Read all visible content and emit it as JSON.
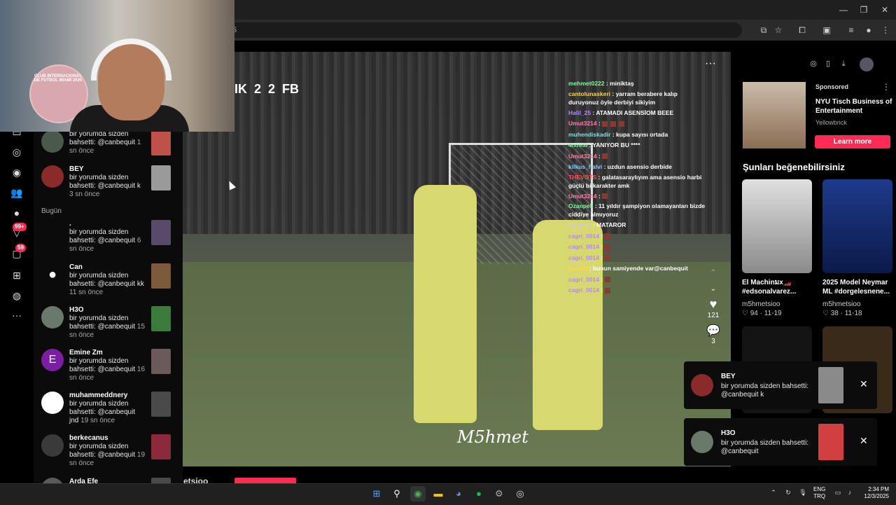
{
  "browser": {
    "url_partial": "5",
    "window_controls": [
      "minimize",
      "maximize",
      "close"
    ]
  },
  "notifications": {
    "section_today": "Bugün",
    "items": [
      {
        "name": "",
        "text": "bir yorumda sizden bahsetti: @canbequit",
        "time": "1 sn önce",
        "avatar": "#4a5a4a",
        "thumb": "#c0504a"
      },
      {
        "name": "BEY",
        "text": "bir yorumda sizden bahsetti: @canbequit k",
        "time": "3 sn önce",
        "avatar": "#8a2a2a",
        "thumb": "#9a9a9a"
      },
      {
        "name": ".",
        "text": "bir yorumda sizden bahsetti: @canbequit",
        "time": "6 sn önce",
        "avatar": "#0b0b0b",
        "thumb": "#5a4a6a"
      },
      {
        "name": "Can",
        "text": "bir yorumda sizden bahsetti: @canbequit kk",
        "time": "11 sn önce",
        "avatar": "#ffffff",
        "thumb": "#7a5a3a"
      },
      {
        "name": "H3O",
        "text": "bir yorumda sizden bahsetti: @canbequit",
        "time": "15 sn önce",
        "avatar": "#6a7a6a",
        "thumb": "#3a7a3a"
      },
      {
        "name": "Emine Zm",
        "text": "bir yorumda sizden bahsetti: @canbequit",
        "time": "16 sn önce",
        "avatar": "#7b1fa2",
        "avatar_letter": "E",
        "thumb": "#6a5a5a"
      },
      {
        "name": "muhammeddnery",
        "text": "bir yorumda sizden bahsetti: @canbequit jnd",
        "time": "19 sn önce",
        "avatar": "#ffffff",
        "thumb": "#4a4a4a"
      },
      {
        "name": "berkecanus",
        "text": "bir yorumda sizden bahsetti: @canbequit",
        "time": "19 sn önce",
        "avatar": "#3a3a3a",
        "thumb": "#8a2a3a"
      },
      {
        "name": "Arda Efe",
        "text": "",
        "time": "",
        "avatar": "#5a5a5a",
        "thumb": "#4a4a4a"
      }
    ]
  },
  "rail": {
    "badges": {
      "inbox": "99+",
      "messages": "59"
    }
  },
  "video": {
    "scorebug": {
      "home": "IK",
      "home_score": "2",
      "away_score": "2",
      "away": "FB"
    },
    "watermark": "M5hmet",
    "likes": "121",
    "comments": "3",
    "chat": [
      {
        "user": "mehmet0222",
        "color": "#7cfc9a",
        "text": "miniktaş"
      },
      {
        "user": "cantolunaskeri",
        "color": "#ffd54a",
        "text": "yarram berabere kalıp duruyonuz öyle derbiyi sikiyim",
        "wrap": true
      },
      {
        "user": "Halil_25",
        "color": "#b388ff",
        "text": "ATAMADI ASENSİOM BEEE"
      },
      {
        "user": "Umut3214",
        "color": "#ff80ab",
        "text": "",
        "emotes": 3
      },
      {
        "user": "muhendiskadir",
        "color": "#80deea",
        "text": "kupa sayısı ortada"
      },
      {
        "user": "4lxreal",
        "color": "#7cfc9a",
        "text": "YANIYOR BU ****"
      },
      {
        "user": "Umut3214",
        "color": "#ff80ab",
        "text": "",
        "emotes": 1
      },
      {
        "user": "kilkus_halvi",
        "color": "#90caf9",
        "text": "uzdun asensio derbide"
      },
      {
        "user": "THEVOTS",
        "color": "#ff5252",
        "text": "galatasaraylıyım ama asensio harbi güçlü bi karakter amk",
        "wrap": true
      },
      {
        "user": "Umut3214",
        "color": "#ff80ab",
        "text": "",
        "emotes": 1
      },
      {
        "user": "Ozanpeli",
        "color": "#7cfc9a",
        "text": "11 yıldır şampiyon olamayanları bizde ciddiye almıyoruz",
        "wrap": true
      },
      {
        "user": "smaisor",
        "color": "#cccccc",
        "text": "MATAROR"
      },
      {
        "user": "cagri_0014",
        "color": "#b388ff",
        "text": "",
        "emotes": 1
      },
      {
        "user": "cagri_0014",
        "color": "#b388ff",
        "text": "",
        "emotes": 1
      },
      {
        "user": "cagri_0014",
        "color": "#b388ff",
        "text": "",
        "emotes": 1
      },
      {
        "user": "mustlll",
        "color": "#ffd54a",
        "text": "bunun samiyende var@canbequit"
      },
      {
        "user": "cagri_0014",
        "color": "#b388ff",
        "text": "",
        "emotes": 1
      },
      {
        "user": "cagri_0014",
        "color": "#b388ff",
        "text": "",
        "emotes": 1
      }
    ]
  },
  "ad": {
    "sponsored": "Sponsored",
    "title": "NYU Tisch Business of Entertainment",
    "brand": "Yellowbrick",
    "cta": "Learn more"
  },
  "suggestions": {
    "title": "Şunları beğenebilirsiniz",
    "cards": [
      {
        "caption": "El Machinมx🏎️ #edsonalvarez...",
        "author": "m5hmetsioo",
        "likes": "94",
        "date": "11-19",
        "color": "#c8c8c8"
      },
      {
        "caption": "2025 Model Neymar ML #dorgelesnene...",
        "author": "m5hmetsioo",
        "likes": "38",
        "date": "11-18",
        "color": "#1e3a8a"
      }
    ]
  },
  "toasts": [
    {
      "name": "BEY",
      "text": "bir yorumda sizden bahsetti: @canbequit k",
      "avatar": "#8a2a2a",
      "thumb": "#8a8a8a"
    },
    {
      "name": "H3O",
      "text": "bir yorumda sizden bahsetti: @canbequit",
      "avatar": "#6a7a6a",
      "thumb": "#d04040"
    }
  ],
  "webcam": {
    "jersey_text": "CLUB INTERNACIONAL DE FUTBOL MIAMI 2025"
  },
  "bottomstrip": {
    "text": "etsioo"
  },
  "taskbar": {
    "lang_top": "ENG",
    "lang_bottom": "TRQ",
    "time": "2:34 PM",
    "date": "12/3/2025"
  }
}
